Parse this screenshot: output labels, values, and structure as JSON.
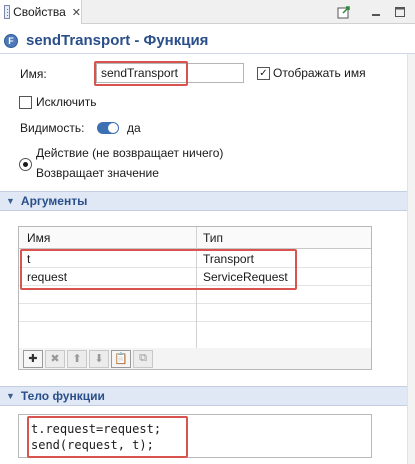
{
  "tab": {
    "label": "Свойства",
    "close": "✕",
    "icon": "properties-icon"
  },
  "toolbar": {
    "buttons": [
      "open-editor-icon",
      "minimize-icon",
      "maximize-icon"
    ]
  },
  "header": {
    "icon_letter": "F",
    "title": "sendTransport - Функция"
  },
  "form": {
    "name_label": "Имя:",
    "name_value": "sendTransport",
    "show_name_label": "Отображать имя",
    "show_name_checked": true,
    "exclude_label": "Исключить",
    "exclude_checked": false,
    "visibility_label": "Видимость:",
    "visibility_value": "да",
    "action_label": "Действие (не возвращает ничего)",
    "returns_label": "Возвращает значение",
    "selected_mode": "action"
  },
  "arguments": {
    "section_label": "Аргументы",
    "columns": [
      "Имя",
      "Тип"
    ],
    "rows": [
      {
        "name": "t",
        "type": "Transport"
      },
      {
        "name": "request",
        "type": "ServiceRequest"
      }
    ],
    "buttons": {
      "add": "✚",
      "remove": "✖",
      "up": "⬆",
      "down": "⬇",
      "paste": "📋",
      "copy": "⧉"
    }
  },
  "body": {
    "section_label": "Тело функции",
    "code_lines": [
      "t.request=request;",
      "send(request, t);"
    ]
  },
  "colors": {
    "accent": "#2a4f8a",
    "highlight": "#d9534f",
    "section_bg": "#dfe8f4"
  }
}
